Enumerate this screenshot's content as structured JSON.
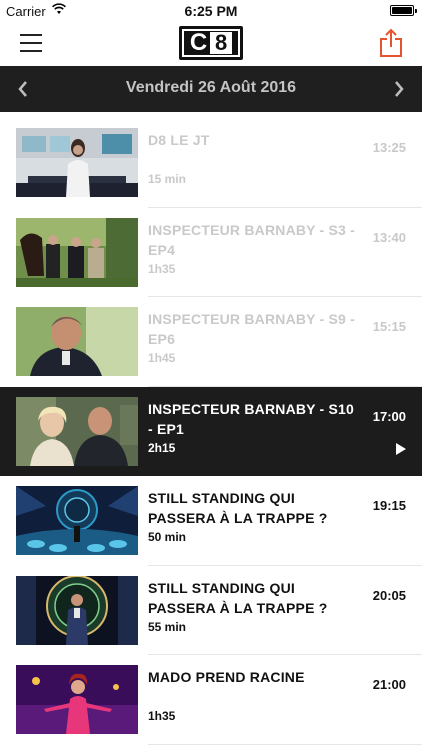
{
  "status_bar": {
    "carrier": "Carrier",
    "time": "6:25 PM"
  },
  "header": {
    "logo": "C8",
    "icons": [
      "menu-icon",
      "share-icon"
    ]
  },
  "date_nav": {
    "date": "Vendredi 26 Août 2016",
    "prev_icon": "chevron-left-icon",
    "next_icon": "chevron-right-icon"
  },
  "colors": {
    "accent_share": "#e8532f",
    "current_bg": "#1c1c1c",
    "past_text": "#c9c9c9"
  },
  "programs": [
    {
      "title": "D8 LE JT",
      "time": "13:25",
      "duration": "15 min",
      "state": "past"
    },
    {
      "title": "INSPECTEUR BARNABY - S3 - EP4",
      "time": "13:40",
      "duration": "1h35",
      "state": "past"
    },
    {
      "title": "INSPECTEUR BARNABY - S9 - EP6",
      "time": "15:15",
      "duration": "1h45",
      "state": "past"
    },
    {
      "title": "INSPECTEUR BARNABY - S10 - EP1",
      "time": "17:00",
      "duration": "2h15",
      "state": "current"
    },
    {
      "title": "STILL STANDING QUI PASSERA À LA TRAPPE ?",
      "time": "19:15",
      "duration": "50 min",
      "state": "upcoming"
    },
    {
      "title": "STILL STANDING QUI PASSERA À LA TRAPPE ?",
      "time": "20:05",
      "duration": "55 min",
      "state": "upcoming"
    },
    {
      "title": "MADO PREND RACINE",
      "time": "21:00",
      "duration": "1h35",
      "state": "upcoming"
    }
  ]
}
